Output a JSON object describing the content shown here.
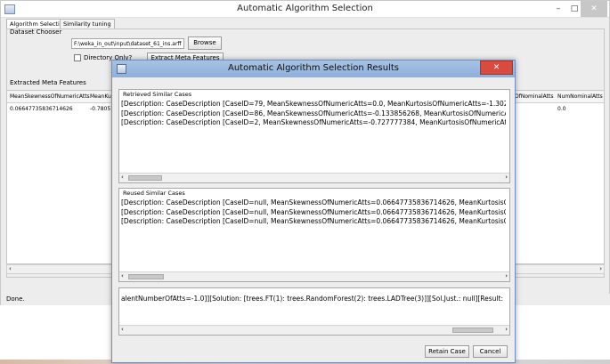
{
  "main": {
    "title": "Automatic Algorithm Selection",
    "controls": {
      "minimize": "–",
      "maximize": "□",
      "close": "✕"
    },
    "tabs": [
      {
        "label": "Algorithm Selection"
      },
      {
        "label": "Similarity tuning"
      }
    ],
    "dataset_chooser": {
      "label": "Dataset Chooser",
      "path_value": "F:\\weka_in_out\\input\\dataset_61_ins.arff",
      "browse_label": "Browse",
      "directory_only_label": "Directory Only?",
      "directory_only_checked": false,
      "extract_label": "Extract Meta Features"
    },
    "meta_features": {
      "label": "Extracted Meta Features",
      "columns": [
        "MeanSkewnessOfNumericAtts",
        "MeanKu",
        "OfNominalAtts",
        "NumNominalAtts"
      ],
      "row": [
        "0.06647735836714626",
        "-0.78057",
        "",
        "0.0"
      ]
    },
    "status": "Done."
  },
  "dialog": {
    "title": "Automatic Algorithm Selection Results",
    "close": "✕",
    "retrieved": {
      "title": "Retrieved Similar Cases",
      "lines": [
        "[Description: CaseDescription [CaseID=79, MeanSkewnessOfNumericAtts=0.0, MeanKurtosisOfNumericAtts=-1.30272, M",
        "[Description: CaseDescription [CaseID=86, MeanSkewnessOfNumericAtts=-0.133856268, MeanKurtosisOfNumericAtts=-0",
        "[Description: CaseDescription [CaseID=2, MeanSkewnessOfNumericAtts=-0.727777384, MeanKurtosisOfNumericAtts=8."
      ]
    },
    "reused": {
      "title": "Reused Similar Cases",
      "lines": [
        "[Description: CaseDescription [CaseID=null, MeanSkewnessOfNumericAtts=0.06647735836714626, MeanKurtosisOfNum",
        "[Description: CaseDescription [CaseID=null, MeanSkewnessOfNumericAtts=0.06647735836714626, MeanKurtosisOfNum",
        "[Description: CaseDescription [CaseID=null, MeanSkewnessOfNumericAtts=0.06647735836714626, MeanKurtosisOfNum"
      ]
    },
    "solution": {
      "lines": [
        "alentNumberOfAtts=-1.0]][Solution: [trees.FT(1): trees.RandomForest(2): trees.LADTree(3)]][Sol.Just.: null][Result: null]"
      ]
    },
    "retain_label": "Retain Case",
    "cancel_label": "Cancel"
  }
}
